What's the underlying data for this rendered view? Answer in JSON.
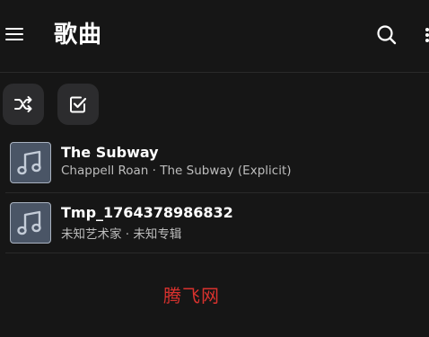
{
  "header": {
    "title": "歌曲"
  },
  "toolbar": {
    "shuffle_icon": "shuffle-icon",
    "select_icon": "checkbox-icon"
  },
  "tracks": [
    {
      "title": "The Subway",
      "subtitle": "Chappell Roan · The Subway (Explicit)",
      "art_icon": "music-note-icon"
    },
    {
      "title": "Tmp_1764378986832",
      "subtitle": "未知艺术家 · 未知专辑",
      "art_icon": "music-note-icon"
    }
  ],
  "watermark": "腾飞网",
  "colors": {
    "background": "#161616",
    "button_bg": "#2c2c2e",
    "art_bg": "#4a5566",
    "watermark": "#d9322e"
  }
}
